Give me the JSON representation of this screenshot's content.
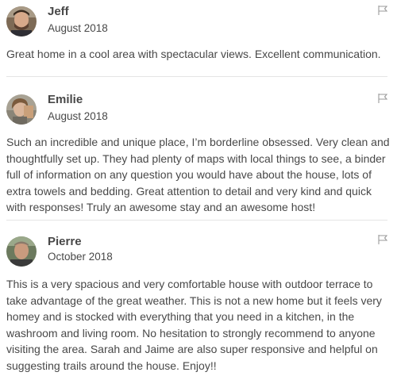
{
  "reviews": [
    {
      "name": "Jeff",
      "date": "August 2018",
      "text": "Great home in a cool area with spectacular views. Excellent communication.",
      "avatar": "avatar-jeff",
      "flag_icon": "flag-icon"
    },
    {
      "name": "Emilie",
      "date": "August 2018",
      "text": "Such an incredible and unique place, I’m borderline obsessed. Very clean and thoughtfully set up. They had plenty of maps with local things to see, a binder full of information on any question you would have about the house, lots of extra towels and bedding. Great attention to detail and very kind and quick with responses! Truly an awesome stay and an awesome host!",
      "avatar": "avatar-emilie",
      "flag_icon": "flag-icon"
    },
    {
      "name": "Pierre",
      "date": "October 2018",
      "text": "This is a very spacious and very comfortable house with outdoor terrace to take advantage of the great weather. This is not a new home but it feels very homey and is stocked with everything that you need in a kitchen, in the washroom and living room. No hesitation to strongly recommend to anyone visiting the area. Sarah and Jaime are also super responsive and helpful on suggesting trails around the house. Enjoy!!",
      "avatar": "avatar-pierre",
      "flag_icon": "flag-icon"
    }
  ],
  "colors": {
    "text": "#484848",
    "divider": "#e4e4e4",
    "flag": "#9a9a9a"
  }
}
